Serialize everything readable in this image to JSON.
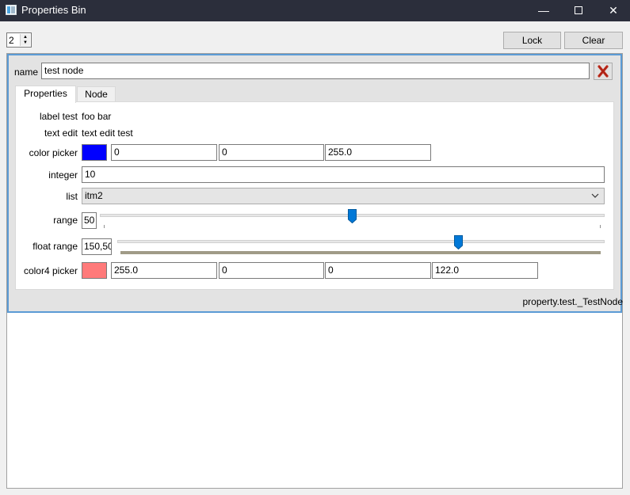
{
  "window": {
    "title": "Properties Bin",
    "minimize_glyph": "—",
    "close_glyph": "✕"
  },
  "toolbar": {
    "limit_value": "2",
    "spin_up_glyph": "▲",
    "spin_down_glyph": "▼",
    "lock_label": "Lock",
    "clear_label": "Clear"
  },
  "node": {
    "name_label": "name",
    "name_value": "test node",
    "tabs": [
      {
        "label": "Properties"
      },
      {
        "label": "Node"
      }
    ],
    "properties": {
      "label_test": {
        "label": "label test",
        "value": "foo bar"
      },
      "text_edit": {
        "label": "text edit",
        "value": "text edit test"
      },
      "color_picker": {
        "label": "color picker",
        "swatch_color": "#0000ff",
        "values": [
          "0",
          "0",
          "255.0"
        ]
      },
      "integer": {
        "label": "integer",
        "value": "10"
      },
      "list": {
        "label": "list",
        "selected": "itm2"
      },
      "range": {
        "label": "range",
        "value": "50",
        "fraction": 0.5
      },
      "float_range": {
        "label": "float range",
        "value": "150,50",
        "fraction": 0.7
      },
      "color4_picker": {
        "label": "color4 picker",
        "swatch_color": "#ff7a7a",
        "values": [
          "255.0",
          "0",
          "0",
          "122.0"
        ]
      }
    },
    "class_name": "property.test._TestNode"
  },
  "colors": {
    "titlebar": "#2b2e3b",
    "panel_border": "#5b9bd5",
    "slider_handle": "#0078d7",
    "delete_red": "#c42b1c"
  }
}
